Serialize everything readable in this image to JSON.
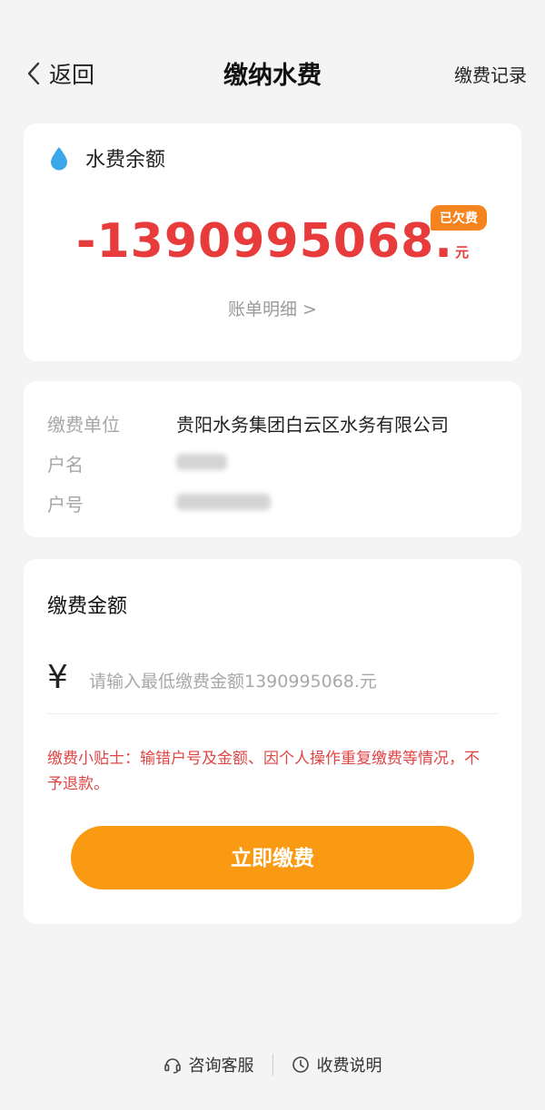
{
  "nav": {
    "back_label": "返回",
    "title": "缴纳水费",
    "right_link": "缴费记录"
  },
  "balance": {
    "label": "水费余额",
    "amount": "-1390995068.",
    "unit": "元",
    "badge": "已欠费",
    "detail_link": "账单明细 >"
  },
  "info": {
    "rows": [
      {
        "label": "缴费单位",
        "value": "贵阳水务集团白云区水务有限公司"
      },
      {
        "label": "户名",
        "value": ""
      },
      {
        "label": "户号",
        "value": ""
      }
    ]
  },
  "payment": {
    "title": "缴费金额",
    "currency": "¥",
    "input_value": "",
    "input_placeholder": "请输入最低缴费金额1390995068.元",
    "tips": "缴费小贴士：输错户号及金额、因个人操作重复缴费等情况，不予退款。",
    "button_label": "立即缴费"
  },
  "footer": {
    "service_label": "咨询客服",
    "fee_label": "收费说明"
  },
  "colors": {
    "accent_orange": "#f99a12",
    "badge_orange": "#f5841f",
    "debt_red": "#e83b3b",
    "tip_red": "#e04545",
    "water_blue": "#3aa8e8"
  },
  "icons": {
    "back": "chevron-left-icon",
    "water": "water-drop-icon",
    "service": "headset-icon",
    "fee": "clock-icon"
  }
}
